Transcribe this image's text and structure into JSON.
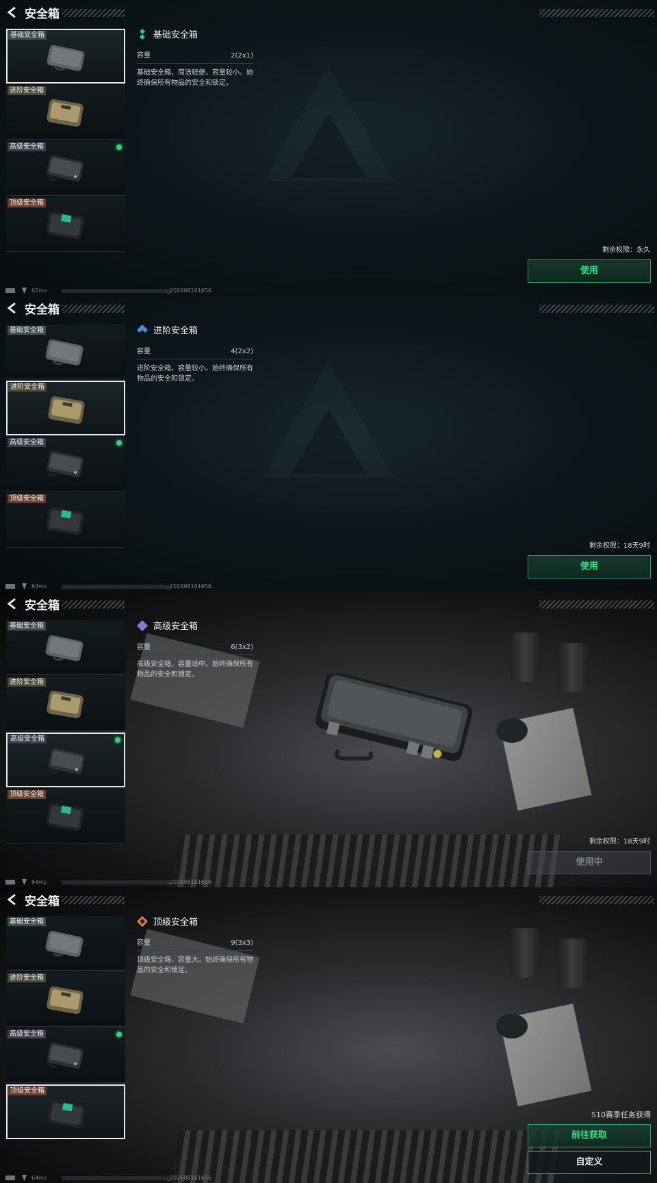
{
  "status": {
    "id_suffix": "_202608161656"
  },
  "panels": [
    {
      "title": "安全箱",
      "items": [
        "基础安全箱",
        "进阶安全箱",
        "高级安全箱",
        "顶级安全箱"
      ],
      "detail": {
        "name": "基础安全箱",
        "capacity_label": "容量",
        "capacity_value": "2(2x1)",
        "desc_line1": "基础安全箱，简洁轻便，容量较小。始",
        "desc_line2": "终确保所有物品的安全和锁定。"
      },
      "remain": "剩余权限：永久",
      "button": "使用",
      "ping": "62ms"
    },
    {
      "title": "安全箱",
      "items": [
        "基础安全箱",
        "进阶安全箱",
        "高级安全箱",
        "顶级安全箱"
      ],
      "detail": {
        "name": "进阶安全箱",
        "capacity_label": "容量",
        "capacity_value": "4(2x2)",
        "desc_line1": "进阶安全箱，容量较小。始终确保所有",
        "desc_line2": "物品的安全和锁定。"
      },
      "remain": "剩余权限：18天9时",
      "button": "使用",
      "ping": "64ms"
    },
    {
      "title": "安全箱",
      "items": [
        "基础安全箱",
        "进阶安全箱",
        "高级安全箱",
        "顶级安全箱"
      ],
      "detail": {
        "name": "高级安全箱",
        "capacity_label": "容量",
        "capacity_value": "6(3x2)",
        "desc_line1": "高级安全箱，容量适中。始终确保所有",
        "desc_line2": "物品的安全和锁定。"
      },
      "remain": "剩余权限：18天9时",
      "button": "使用中",
      "ping": "64ms"
    },
    {
      "title": "安全箱",
      "items": [
        "基础安全箱",
        "进阶安全箱",
        "高级安全箱",
        "顶级安全箱"
      ],
      "detail": {
        "name": "顶级安全箱",
        "capacity_label": "容量",
        "capacity_value": "9(3x3)",
        "desc_line1": "顶级安全箱，容量大。始终确保所有物",
        "desc_line2": "品的安全和锁定。"
      },
      "source": "S10赛季任务获得",
      "button_get": "前往获取",
      "button_custom": "自定义",
      "ping": "64ms"
    }
  ],
  "colors": {
    "accent_green": "#43e08d",
    "equipped_dot": "#35d27a",
    "rarity_basic": "#3bbf9a",
    "rarity_advanced": "#4c8fd6",
    "rarity_high": "#9a72d9",
    "rarity_top": "#e07a50"
  },
  "icons": [
    "back-arrow-icon",
    "rarity-icon",
    "equipped-dot-icon",
    "signal-icon",
    "wifi-icon",
    "case-icon"
  ]
}
